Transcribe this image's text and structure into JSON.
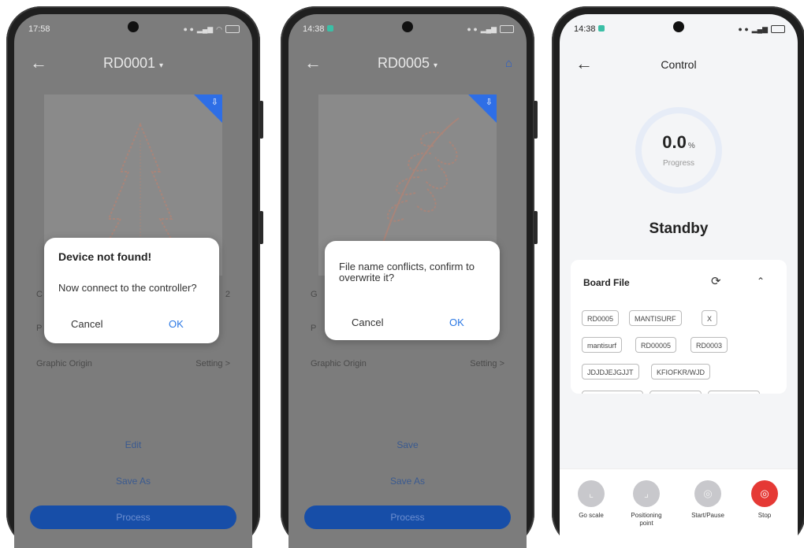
{
  "phone1": {
    "time": "17:58",
    "title": "RD0001",
    "row_graphic_origin": "Graphic Origin",
    "row_setting": "Setting",
    "row_c_peek": "C",
    "row_c_right": "2",
    "row_p_peek": "P",
    "edit_label": "Edit",
    "save_as_label": "Save As",
    "process_label": "Process",
    "dialog": {
      "title": "Device not found!",
      "message": "Now connect to the controller?",
      "cancel": "Cancel",
      "ok": "OK"
    }
  },
  "phone2": {
    "time": "14:38",
    "title": "RD0005",
    "row_graphic_origin": "Graphic Origin",
    "row_setting": "Setting",
    "row_g_peek": "G",
    "row_p_peek": "P",
    "save_label": "Save",
    "save_as_label": "Save As",
    "process_label": "Process",
    "dialog": {
      "message": "File name conflicts, confirm to overwrite it?",
      "cancel": "Cancel",
      "ok": "OK"
    }
  },
  "phone3": {
    "time": "14:38",
    "title": "Control",
    "progress_value": "0.0",
    "progress_unit": "%",
    "progress_label": "Progress",
    "state": "Standby",
    "board_file_label": "Board File",
    "files": [
      "RD0005",
      "MANTISURF",
      "X",
      "mantisurf",
      "RD00005",
      "RD0003",
      "JDJDJEJGJJT",
      "KFIOFKR/WJD"
    ],
    "actions": [
      {
        "label": "Go scale"
      },
      {
        "label": "Positioning point"
      },
      {
        "label": "Start/Pause"
      },
      {
        "label": "Stop"
      }
    ]
  },
  "colors": {
    "accent_blue": "#2b78e4",
    "process_button": "#174ea8",
    "stop_red": "#e53935",
    "disabled_gray": "#c8c8cc"
  },
  "icons": {
    "back": "arrow-left-icon",
    "dropdown": "caret-down-icon",
    "home": "home-icon",
    "refresh": "refresh-icon",
    "collapse": "chevron-up-icon",
    "stop": "stop-icon"
  }
}
